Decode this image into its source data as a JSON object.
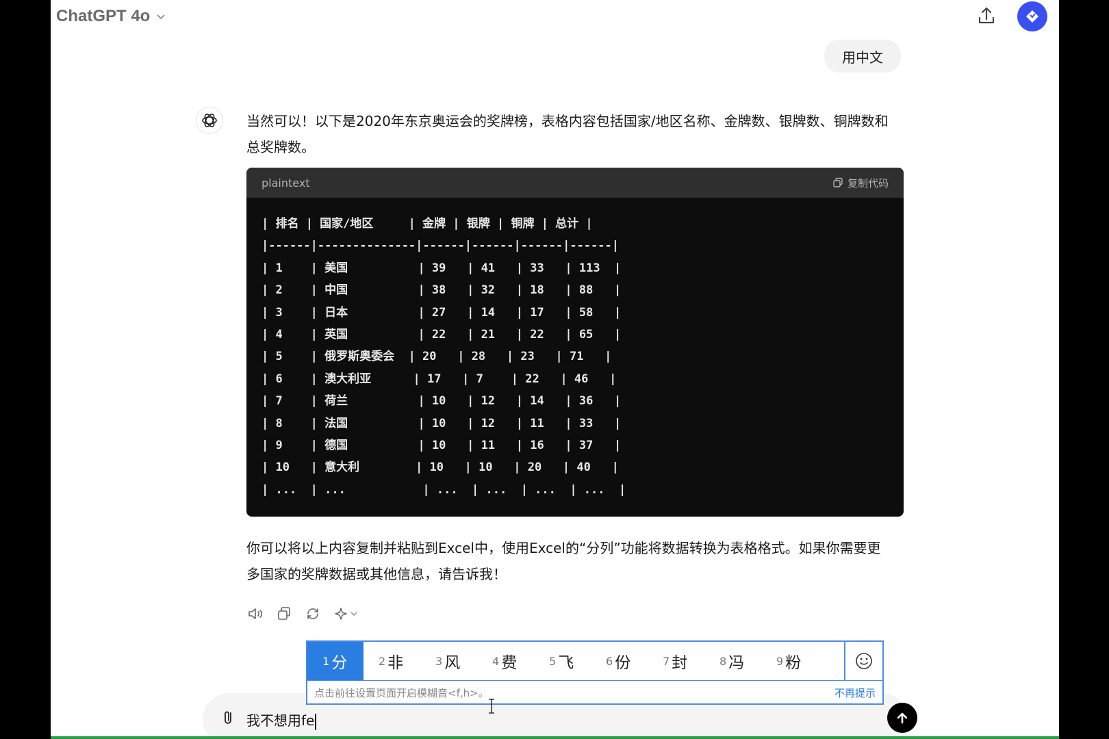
{
  "header": {
    "model_name": "ChatGPT 4o"
  },
  "conversation": {
    "user_message": "用中文",
    "assistant_intro": "当然可以！以下是2020年东京奥运会的奖牌榜，表格内容包括国家/地区名称、金牌数、银牌数、铜牌数和总奖牌数。",
    "code_block": {
      "language": "plaintext",
      "copy_label": "复制代码",
      "header_row": "| 排名 | 国家/地区     | 金牌 | 银牌 | 铜牌 | 总计 |",
      "separator_row": "|------|--------------|------|------|------|------|",
      "rows": [
        "| 1    | 美国          | 39   | 41   | 33   | 113  |",
        "| 2    | 中国          | 38   | 32   | 18   | 88   |",
        "| 3    | 日本          | 27   | 14   | 17   | 58   |",
        "| 4    | 英国          | 22   | 21   | 22   | 65   |",
        "| 5    | 俄罗斯奥委会  | 20   | 28   | 23   | 71   |",
        "| 6    | 澳大利亚      | 17   | 7    | 22   | 46   |",
        "| 7    | 荷兰          | 10   | 12   | 14   | 36   |",
        "| 8    | 法国          | 10   | 12   | 11   | 33   |",
        "| 9    | 德国          | 10   | 11   | 16   | 37   |",
        "| 10   | 意大利        | 10   | 10   | 20   | 40   |",
        "| ...  | ...           | ...  | ...  | ...  | ...  |"
      ]
    },
    "assistant_outro": "你可以将以上内容复制并粘贴到Excel中，使用Excel的“分列”功能将数据转换为表格格式。如果你需要更多国家的奖牌数据或其他信息，请告诉我！"
  },
  "message_actions": [
    "read-aloud-icon",
    "copy-icon",
    "regenerate-icon",
    "sparkle-model-icon"
  ],
  "composer": {
    "text": "我不想用fe"
  },
  "ime": {
    "candidates": [
      {
        "num": "1",
        "text": "分"
      },
      {
        "num": "2",
        "text": "非"
      },
      {
        "num": "3",
        "text": "风"
      },
      {
        "num": "4",
        "text": "费"
      },
      {
        "num": "5",
        "text": "飞"
      },
      {
        "num": "6",
        "text": "份"
      },
      {
        "num": "7",
        "text": "封"
      },
      {
        "num": "8",
        "text": "冯"
      },
      {
        "num": "9",
        "text": "粉"
      }
    ],
    "hint": "点击前往设置页面开启模糊音<f,h>。",
    "dismiss": "不再提示"
  },
  "colors": {
    "accent": "#2a7de1",
    "avatar": "#3a4ff0",
    "code_bg": "#0d0d0d"
  }
}
